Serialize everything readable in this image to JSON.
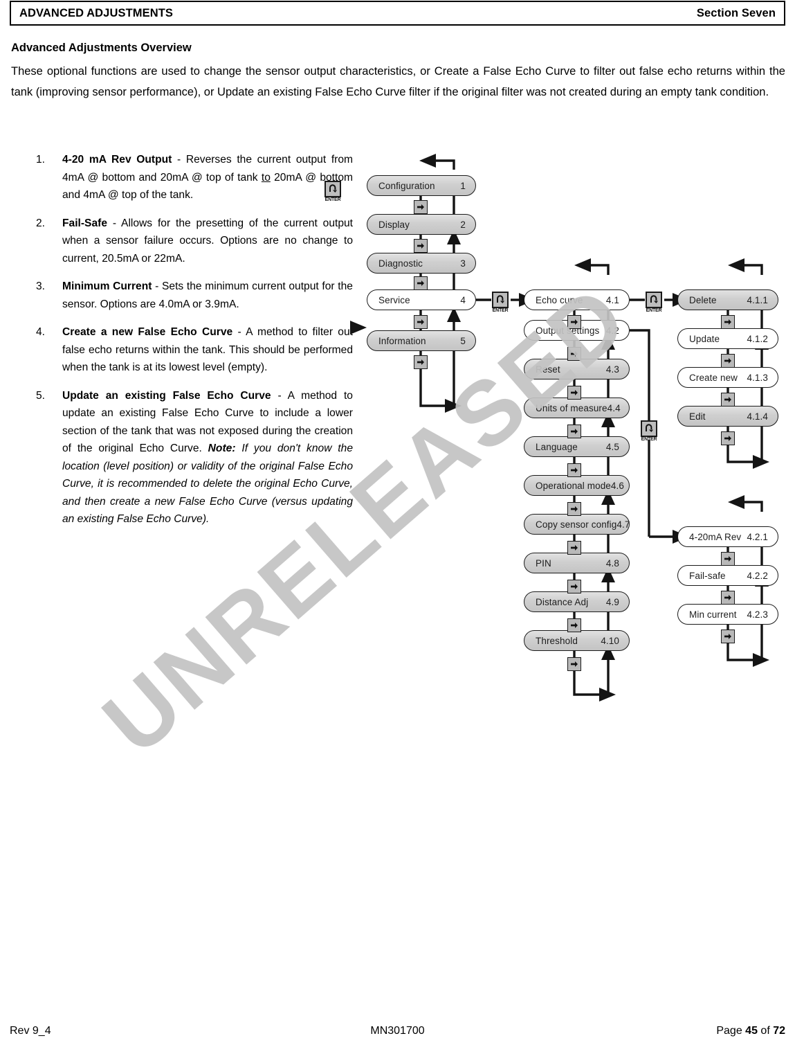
{
  "header": {
    "left_title": "ADVANCED ADJUSTMENTS",
    "right_title": "Section Seven"
  },
  "overview": {
    "title": "Advanced Adjustments Overview",
    "paragraph": "These optional functions are used to change the sensor output characteristics, or Create a False Echo Curve to filter out false echo returns within the tank (improving sensor performance), or Update an existing False Echo Curve filter if the original filter was not created during an empty tank condition."
  },
  "features": [
    {
      "number": "1.",
      "term": "4-20 mA Rev Output",
      "body_1": " - Reverses the current output from 4mA @ bottom and 20mA @ top of tank ",
      "underlined": "to",
      "body_2": " 20mA @ bottom and 4mA @ top of the tank."
    },
    {
      "number": "2.",
      "term": "Fail-Safe",
      "body_1": " - Allows for the presetting of the current output when a sensor failure occurs. Options are no change to current, 20.5mA or 22mA."
    },
    {
      "number": "3.",
      "term": "Minimum Current",
      "body_1": " - Sets the minimum current output for the sensor. Options are 4.0mA or 3.9mA."
    },
    {
      "number": "4.",
      "term": "Create a new False Echo Curve",
      "body_1": " - A method to filter out false echo returns within the tank.  This should be performed when the tank is at its lowest level (empty)."
    },
    {
      "number": "5.",
      "term": "Update an existing False Echo Curve",
      "body_1": " - A method to update an existing False Echo Curve to include a lower section of the tank that was not exposed during the creation of the original Echo Curve. ",
      "note_label": "Note:",
      "note_body": "  If you don't know the location (level position) or validity of the original False Echo Curve, it is recommended to delete the original Echo Curve, and then create a new False Echo Curve (versus updating an existing False Echo Curve)."
    }
  ],
  "watermark": {
    "text": "UNRELEASED",
    "color": "#c3c3c3"
  },
  "diagram": {
    "enter_label": "ENTER",
    "menu_level_1": [
      {
        "label": "Configuration",
        "index": "1",
        "state": "gray"
      },
      {
        "label": "Display",
        "index": "2",
        "state": "gray"
      },
      {
        "label": "Diagnostic",
        "index": "3",
        "state": "gray"
      },
      {
        "label": "Service",
        "index": "4",
        "state": "white"
      },
      {
        "label": "Information",
        "index": "5",
        "state": "gray"
      }
    ],
    "menu_level_2": [
      {
        "label": "Echo curve",
        "index": "4.1",
        "state": "white"
      },
      {
        "label": "Output settings",
        "index": "4.2",
        "state": "white"
      },
      {
        "label": "Reset",
        "index": "4.3",
        "state": "gray"
      },
      {
        "label": "Units of measure",
        "index": "4.4",
        "state": "gray"
      },
      {
        "label": "Language",
        "index": "4.5",
        "state": "gray"
      },
      {
        "label": "Operational mode",
        "index": "4.6",
        "state": "gray"
      },
      {
        "label": "Copy sensor config",
        "index": "4.7",
        "state": "gray"
      },
      {
        "label": "PIN",
        "index": "4.8",
        "state": "gray"
      },
      {
        "label": "Distance Adj",
        "index": "4.9",
        "state": "gray"
      },
      {
        "label": "Threshold",
        "index": "4.10",
        "state": "gray"
      }
    ],
    "menu_level_3_echo": [
      {
        "label": "Delete",
        "index": "4.1.1",
        "state": "gray"
      },
      {
        "label": "Update",
        "index": "4.1.2",
        "state": "white"
      },
      {
        "label": "Create new",
        "index": "4.1.3",
        "state": "white"
      },
      {
        "label": "Edit",
        "index": "4.1.4",
        "state": "gray"
      }
    ],
    "menu_level_3_output": [
      {
        "label": "4-20mA Rev",
        "index": "4.2.1",
        "state": "white"
      },
      {
        "label": "Fail-safe",
        "index": "4.2.2",
        "state": "white"
      },
      {
        "label": "Min current",
        "index": "4.2.3",
        "state": "white"
      }
    ]
  },
  "footer": {
    "revision": "Rev 9_4",
    "document_number": "MN301700",
    "page_prefix": "Page ",
    "page_number": "45",
    "page_of": " of ",
    "page_total": "72"
  }
}
